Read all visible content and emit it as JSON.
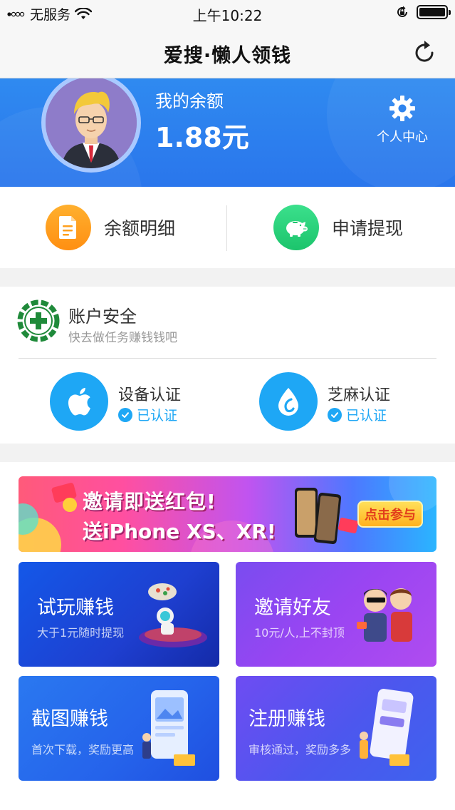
{
  "status_bar": {
    "carrier": "无服务",
    "time": "上午10:22"
  },
  "nav": {
    "title": "爱搜·懒人领钱",
    "refresh_icon": "refresh-icon"
  },
  "header": {
    "balance_label": "我的余额",
    "balance_value": "1.88元",
    "personal_center_label": "个人中心",
    "colors": {
      "primary": "#2f8af0"
    }
  },
  "actions": [
    {
      "label": "余额明细",
      "icon": "document-icon",
      "color": "#ff9f1c"
    },
    {
      "label": "申请提现",
      "icon": "piggy-bank-icon",
      "color": "#26d07c"
    }
  ],
  "security": {
    "title": "账户安全",
    "subtitle": "快去做任务赚钱钱吧",
    "items": [
      {
        "name": "设备认证",
        "status": "已认证",
        "icon": "apple-icon"
      },
      {
        "name": "芝麻认证",
        "status": "已认证",
        "icon": "sesame-icon"
      }
    ]
  },
  "banner": {
    "line1": "邀请即送红包!",
    "line2": "送iPhone XS、XR!",
    "button": "点击参与"
  },
  "tiles": [
    {
      "title": "试玩赚钱",
      "subtitle": "大于1元随时提现"
    },
    {
      "title": "邀请好友",
      "subtitle": "10元/人,上不封顶"
    },
    {
      "title": "截图赚钱",
      "subtitle": "首次下载，奖励更高"
    },
    {
      "title": "注册赚钱",
      "subtitle": "审核通过，奖励多多"
    }
  ]
}
